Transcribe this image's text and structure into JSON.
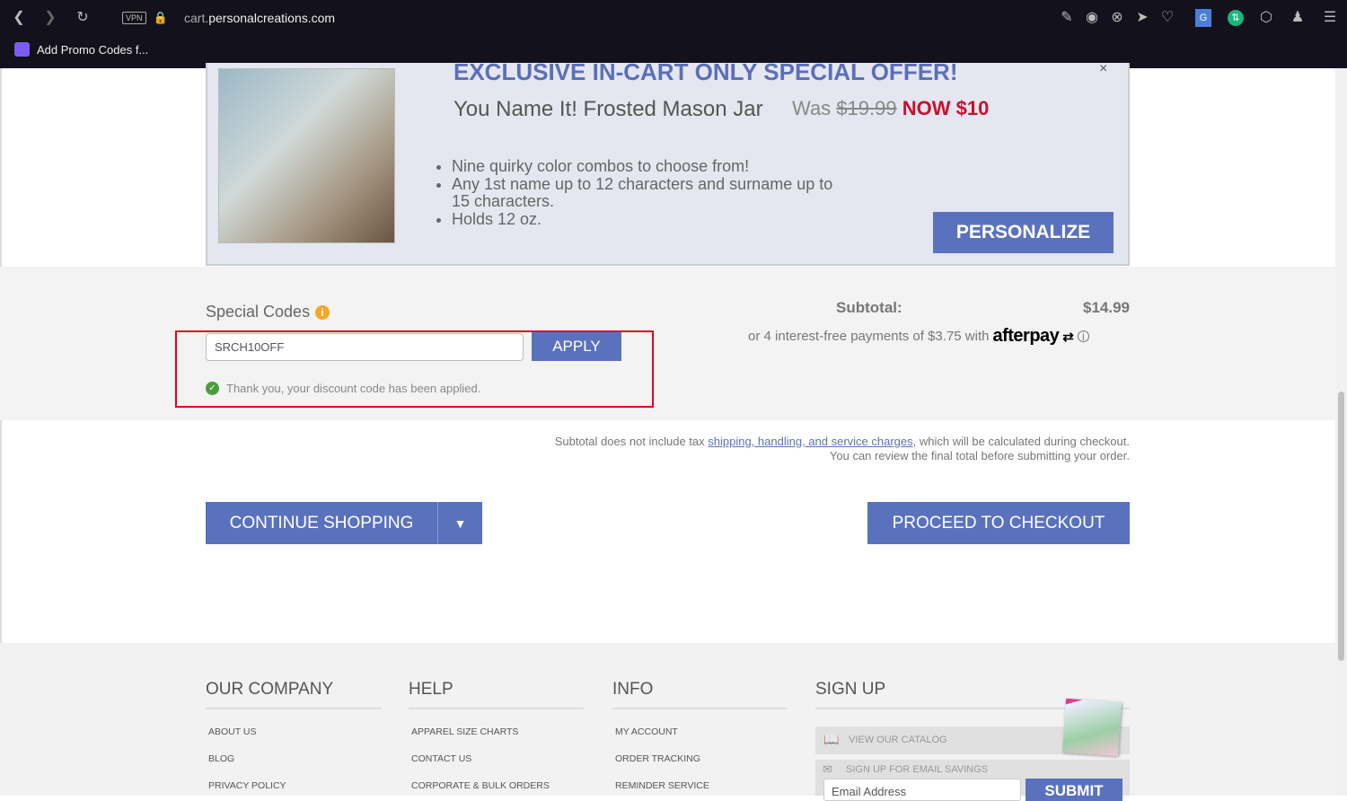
{
  "browser": {
    "url_prefix": "cart.",
    "url_domain": "personalcreations.com",
    "vpn": "VPN",
    "bookmark": "Add Promo Codes f..."
  },
  "offer": {
    "title": "EXCLUSIVE IN-CART ONLY SPECIAL OFFER!",
    "product": "You Name It! Frosted Mason Jar",
    "was_label": "Was",
    "was_price": "$19.99",
    "now": "NOW $10",
    "bullets": [
      "Nine quirky color combos to choose from!",
      "Any 1st name up to 12 characters and surname up to 15 characters.",
      "Holds 12 oz."
    ],
    "button": "PERSONALIZE",
    "close": "×"
  },
  "codes": {
    "label": "Special Codes",
    "info": "i",
    "value": "SRCH10OFF",
    "apply": "APPLY",
    "message": "Thank you, your discount code has been applied."
  },
  "summary": {
    "subtotal_label": "Subtotal:",
    "subtotal": "$14.99",
    "afterpay_text": "or 4 interest-free payments of $3.75 with",
    "afterpay_brand": "afterpay",
    "note_pre": "Subtotal does not include tax ",
    "note_link": "shipping, handling, and service charges",
    "note_post": ", which will be calculated during checkout.",
    "note_line2": "You can review the final total before submitting your order."
  },
  "actions": {
    "continue": "CONTINUE SHOPPING",
    "checkout": "PROCEED TO CHECKOUT"
  },
  "footer": {
    "company": {
      "title": "OUR COMPANY",
      "links": [
        "ABOUT US",
        "BLOG",
        "PRIVACY POLICY"
      ]
    },
    "help": {
      "title": "HELP",
      "links": [
        "APPAREL SIZE CHARTS",
        "CONTACT US",
        "CORPORATE & BULK ORDERS"
      ]
    },
    "info": {
      "title": "INFO",
      "links": [
        "MY ACCOUNT",
        "ORDER TRACKING",
        "REMINDER SERVICE"
      ]
    },
    "signup": {
      "title": "SIGN UP",
      "catalog": "VIEW OUR CATALOG",
      "email_label": "SIGN UP FOR EMAIL SAVINGS",
      "placeholder": "Email Address",
      "submit": "SUBMIT"
    }
  }
}
